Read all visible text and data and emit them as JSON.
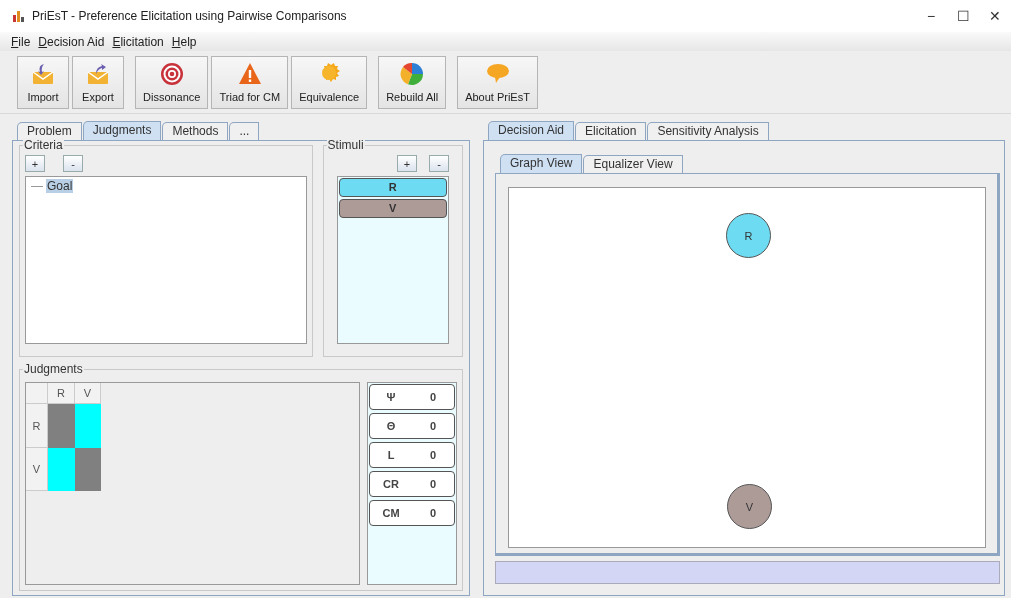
{
  "window": {
    "title": "PriEsT - Preference Elicitation using Pairwise Comparisons",
    "controls": [
      "−",
      "☐",
      "✕"
    ]
  },
  "menu": [
    "File",
    "Decision Aid",
    "Elicitation",
    "Help"
  ],
  "toolbar": [
    [
      {
        "label": "Import",
        "kind": "import"
      },
      {
        "label": "Export",
        "kind": "export"
      }
    ],
    [
      {
        "label": "Dissonance",
        "kind": "target"
      },
      {
        "label": "Triad for CM",
        "kind": "warning"
      },
      {
        "label": "Equivalence",
        "kind": "sun"
      }
    ],
    [
      {
        "label": "Rebuild All",
        "kind": "pie"
      }
    ],
    [
      {
        "label": "About PriEsT",
        "kind": "bubble"
      }
    ]
  ],
  "left_tabs": [
    {
      "label": "Problem",
      "selected": false
    },
    {
      "label": "Judgments",
      "selected": true
    },
    {
      "label": "Methods",
      "selected": false
    },
    {
      "label": "...",
      "selected": false
    }
  ],
  "criteria": {
    "title": "Criteria",
    "buttons": [
      "+",
      "-"
    ],
    "tree": [
      {
        "label": "Goal",
        "selected": true
      }
    ]
  },
  "stimuli": {
    "title": "Stimuli",
    "buttons": [
      "+",
      "-"
    ],
    "items": [
      {
        "label": "R",
        "color": "#6ddcf2"
      },
      {
        "label": "V",
        "color": "#ad9b98"
      }
    ]
  },
  "judgments": {
    "title": "Judgments",
    "columns": [
      "R",
      "V"
    ],
    "rows": [
      {
        "label": "R",
        "cells": [
          {
            "color": "#808080"
          },
          {
            "color": "#00ffff"
          }
        ]
      },
      {
        "label": "V",
        "cells": [
          {
            "color": "#00ffff"
          },
          {
            "color": "#808080"
          }
        ]
      }
    ],
    "indicators": [
      {
        "label": "Ψ",
        "value": "0"
      },
      {
        "label": "Θ",
        "value": "0"
      },
      {
        "label": "L",
        "value": "0"
      },
      {
        "label": "CR",
        "value": "0"
      },
      {
        "label": "CM",
        "value": "0"
      }
    ]
  },
  "right_tabs": [
    {
      "label": "Decision Aid",
      "selected": true
    },
    {
      "label": "Elicitation",
      "selected": false
    },
    {
      "label": "Sensitivity Analysis",
      "selected": false
    }
  ],
  "view_tabs": [
    {
      "label": "Graph View",
      "selected": true
    },
    {
      "label": "Equalizer View",
      "selected": false
    }
  ],
  "graph": {
    "nodes": [
      {
        "label": "R",
        "color": "#6ddcf2"
      },
      {
        "label": "V",
        "color": "#ad9b98"
      }
    ]
  }
}
